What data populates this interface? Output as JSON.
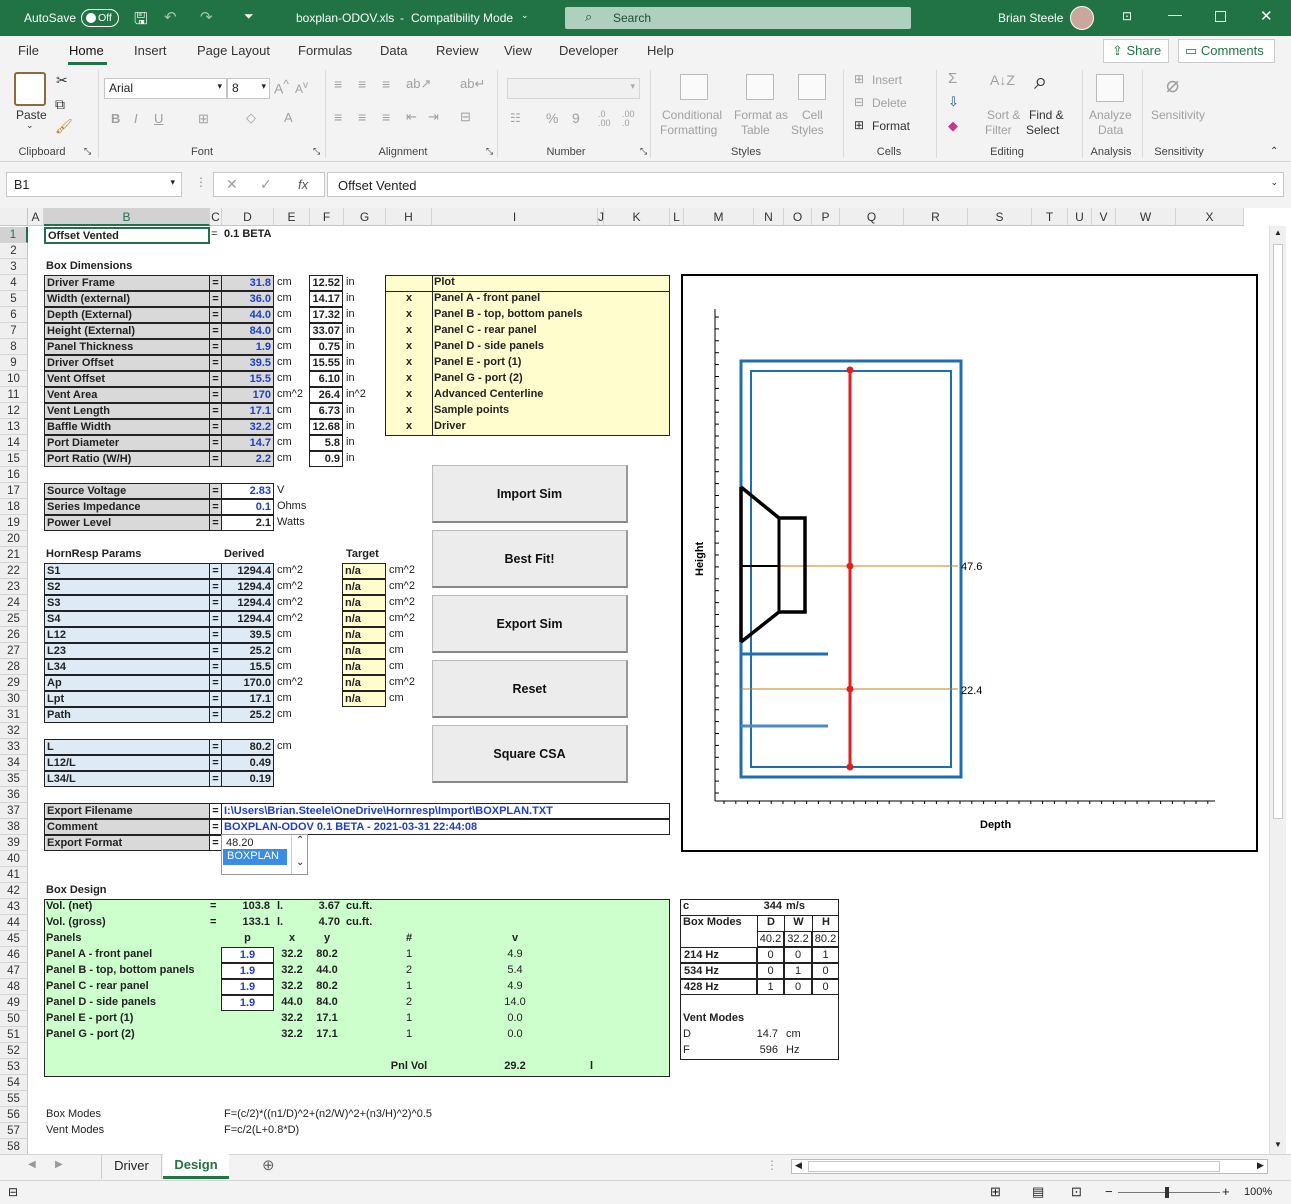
{
  "titlebar": {
    "autosave": "AutoSave",
    "autosave_state": "Off",
    "filename": "boxplan-ODOV.xls",
    "mode": "Compatibility Mode",
    "search": "Search",
    "user": "Brian Steele"
  },
  "tabs": [
    "File",
    "Home",
    "Insert",
    "Page Layout",
    "Formulas",
    "Data",
    "Review",
    "View",
    "Developer",
    "Help"
  ],
  "share": "Share",
  "comments": "Comments",
  "ribbon": {
    "paste": "Paste",
    "font": "Arial",
    "size": "8",
    "clipboard": "Clipboard",
    "font_group": "Font",
    "alignment": "Alignment",
    "number": "Number",
    "styles": "Styles",
    "cells": "Cells",
    "editing": "Editing",
    "analysis": "Analysis",
    "sensitivity": "Sensitivity",
    "cond1": "Conditional",
    "cond2": "Formatting",
    "fmt1": "Format as",
    "fmt2": "Table",
    "cs1": "Cell",
    "cs2": "Styles",
    "insert": "Insert",
    "delete": "Delete",
    "format": "Format",
    "sort1": "Sort &",
    "sort2": "Filter",
    "find1": "Find &",
    "find2": "Select",
    "analyze1": "Analyze",
    "analyze2": "Data",
    "sens": "Sensitivity"
  },
  "formula": {
    "namebox": "B1",
    "content": "Offset Vented"
  },
  "cols": [
    [
      "A",
      28,
      16
    ],
    [
      "B",
      44,
      166
    ],
    [
      "C",
      210,
      12
    ],
    [
      "D",
      222,
      52
    ],
    [
      "E",
      274,
      36
    ],
    [
      "F",
      310,
      34
    ],
    [
      "G",
      344,
      42
    ],
    [
      "H",
      386,
      46
    ],
    [
      "I",
      432,
      166
    ],
    [
      "J",
      598,
      6
    ],
    [
      "K",
      604,
      66
    ],
    [
      "L",
      670,
      14
    ],
    [
      "M",
      684,
      70
    ],
    [
      "N",
      754,
      30
    ],
    [
      "O",
      784,
      28
    ],
    [
      "P",
      812,
      28
    ],
    [
      "Q",
      840,
      64
    ],
    [
      "R",
      904,
      64
    ],
    [
      "S",
      968,
      64
    ],
    [
      "T",
      1032,
      36
    ],
    [
      "U",
      1068,
      24
    ],
    [
      "V",
      1092,
      24
    ],
    [
      "W",
      1116,
      60
    ],
    [
      "X",
      1176,
      68
    ]
  ],
  "cells": {
    "r1b": "Offset Vented",
    "r1c": "=",
    "r1d": "0.1 BETA",
    "r3": "Box Dimensions",
    "dims": [
      [
        "Driver Frame",
        "31.8",
        "cm",
        "12.52",
        "in"
      ],
      [
        "Width (external)",
        "36.0",
        "cm",
        "14.17",
        "in"
      ],
      [
        "Depth (External)",
        "44.0",
        "cm",
        "17.32",
        "in"
      ],
      [
        "Height (External)",
        "84.0",
        "cm",
        "33.07",
        "in"
      ],
      [
        "Panel Thickness",
        "1.9",
        "cm",
        "0.75",
        "in"
      ],
      [
        "Driver Offset",
        "39.5",
        "cm",
        "15.55",
        "in"
      ],
      [
        "Vent Offset",
        "15.5",
        "cm",
        "6.10",
        "in"
      ],
      [
        "Vent Area",
        "170",
        "cm^2",
        "26.4",
        "in^2"
      ],
      [
        "Vent Length",
        "17.1",
        "cm",
        "6.73",
        "in"
      ],
      [
        "Baffle Width",
        "32.2",
        "cm",
        "12.68",
        "in"
      ],
      [
        "Port Diameter",
        "14.7",
        "cm",
        "5.8",
        "in"
      ],
      [
        "Port Ratio (W/H)",
        "2.2",
        "cm",
        "0.9",
        "in"
      ]
    ],
    "plot_title": "Plot",
    "plot": [
      "Panel A - front panel",
      "Panel B - top, bottom panels",
      "Panel C - rear panel",
      "Panel D - side panels",
      "Panel E - port (1)",
      "Panel G - port (2)",
      "Advanced Centerline",
      "Sample points",
      "Driver"
    ],
    "x": "x",
    "src": [
      [
        "Source Voltage",
        "2.83",
        "V"
      ],
      [
        "Series Impedance",
        "0.1",
        "Ohms"
      ],
      [
        "Power Level",
        "2.1",
        "Watts"
      ]
    ],
    "hr_title": "HornResp Params",
    "derived": "Derived",
    "target": "Target",
    "hr": [
      [
        "S1",
        "1294.4",
        "cm^2",
        "n/a",
        "cm^2"
      ],
      [
        "S2",
        "1294.4",
        "cm^2",
        "n/a",
        "cm^2"
      ],
      [
        "S3",
        "1294.4",
        "cm^2",
        "n/a",
        "cm^2"
      ],
      [
        "S4",
        "1294.4",
        "cm^2",
        "n/a",
        "cm^2"
      ],
      [
        "L12",
        "39.5",
        "cm",
        "n/a",
        "cm"
      ],
      [
        "L23",
        "25.2",
        "cm",
        "n/a",
        "cm"
      ],
      [
        "L34",
        "15.5",
        "cm",
        "n/a",
        "cm"
      ],
      [
        "Ap",
        "170.0",
        "cm^2",
        "n/a",
        "cm^2"
      ],
      [
        "Lpt",
        "17.1",
        "cm",
        "n/a",
        "cm"
      ],
      [
        "Path",
        "25.2",
        "cm",
        "",
        ""
      ]
    ],
    "lr": [
      [
        "L",
        "80.2",
        "cm"
      ],
      [
        "L12/L",
        "0.49",
        ""
      ],
      [
        "L34/L",
        "0.19",
        ""
      ]
    ],
    "exp": [
      [
        "Export Filename",
        "I:\\Users\\Brian.Steele\\OneDrive\\Hornresp\\Import\\BOXPLAN.TXT"
      ],
      [
        "Comment",
        "BOXPLAN-ODOV 0.1 BETA - 2021-03-31 22:44:08"
      ],
      [
        "Export Format",
        ""
      ]
    ],
    "list": [
      "48.20",
      "BOXPLAN"
    ],
    "bd_title": "Box Design",
    "vol": [
      [
        "Vol. (net)",
        "=",
        "103.8",
        "l.",
        "3.67",
        "cu.ft."
      ],
      [
        "Vol. (gross)",
        "=",
        "133.1",
        "l.",
        "4.70",
        "cu.ft."
      ]
    ],
    "ph": [
      "Panels",
      "p",
      "x",
      "y",
      "#",
      "v"
    ],
    "panels": [
      [
        "Panel A - front panel",
        "1.9",
        "32.2",
        "80.2",
        "1",
        "4.9"
      ],
      [
        "Panel B - top, bottom panels",
        "1.9",
        "32.2",
        "44.0",
        "2",
        "5.4"
      ],
      [
        "Panel C - rear panel",
        "1.9",
        "32.2",
        "80.2",
        "1",
        "4.9"
      ],
      [
        "Panel D - side panels",
        "1.9",
        "44.0",
        "84.0",
        "2",
        "14.0"
      ],
      [
        "Panel E - port (1)",
        "",
        "32.2",
        "17.1",
        "1",
        "0.0"
      ],
      [
        "Panel G - port (2)",
        "",
        "32.2",
        "17.1",
        "1",
        "0.0"
      ]
    ],
    "pnl": [
      "Pnl Vol",
      "29.2",
      "l"
    ],
    "modes": {
      "c": "c",
      "cval": "344",
      "cu": "m/s",
      "bm": "Box Modes",
      "D": "D",
      "W": "W",
      "H": "H",
      "dv": "40.2",
      "wv": "32.2",
      "hv": "80.2",
      "rows": [
        [
          "214 Hz",
          "0",
          "0",
          "1"
        ],
        [
          "534 Hz",
          "0",
          "1",
          "0"
        ],
        [
          "428 Hz",
          "1",
          "0",
          "0"
        ]
      ],
      "vm": "Vent Modes",
      "vd": "D",
      "vdv": "14.7",
      "vdu": "cm",
      "vf": "F",
      "vfv": "596",
      "vfu": "Hz"
    },
    "f1": [
      "Box Modes",
      "F=(c/2)*((n1/D)^2+(n2/W)^2+(n3/H)^2)^0.5"
    ],
    "f2": [
      "Vent Modes",
      "F=c/2(L+0.8*D)"
    ]
  },
  "buttons": [
    "Import Sim",
    "Best Fit!",
    "Export Sim",
    "Reset",
    "Square CSA"
  ],
  "chart": {
    "ylabel": "Height",
    "xlabel": "Depth",
    "lbl1": "47.6",
    "lbl2": "22.4"
  },
  "sheets": [
    "Driver",
    "Design"
  ],
  "zoom": "100%"
}
